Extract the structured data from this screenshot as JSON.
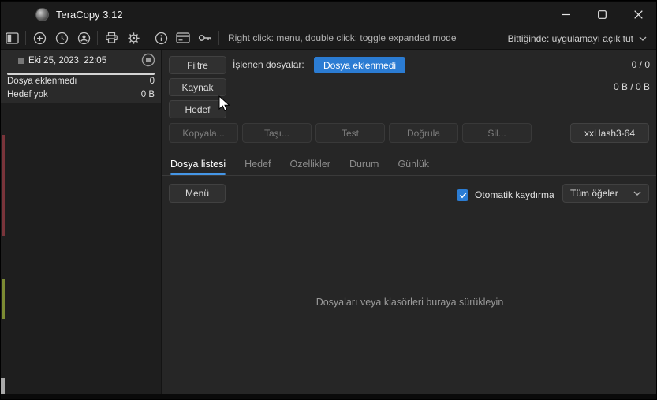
{
  "window": {
    "title": "TeraCopy 3.12"
  },
  "toolbar": {
    "icons": [
      "sidebar-toggle",
      "add",
      "history",
      "user",
      "print",
      "settings",
      "info",
      "license-card",
      "key"
    ],
    "hint": "Right click: menu, double click: toggle expanded mode",
    "on_finish": "Bittiğinde: uygulamayı açık tut"
  },
  "sidebar": {
    "task": {
      "date": "Eki 25, 2023, 22:05",
      "rows": [
        {
          "label": "Dosya eklenmedi",
          "value": "0"
        },
        {
          "label": "Hedef yok",
          "value": "0 B"
        }
      ]
    }
  },
  "main": {
    "filter_button": "Filtre",
    "processed_label": "İşlenen dosyalar:",
    "processed_badge": "Dosya eklenmedi",
    "file_count": "0 / 0",
    "source_button": "Kaynak",
    "byte_count": "0 B / 0 B",
    "target_button": "Hedef",
    "actions": [
      "Kopyala...",
      "Taşı...",
      "Test",
      "Doğrula",
      "Sil..."
    ],
    "hash_button": "xxHash3-64",
    "tabs": [
      "Dosya listesi",
      "Hedef",
      "Özellikler",
      "Durum",
      "Günlük"
    ],
    "active_tab": "Dosya listesi",
    "menu_button": "Menü",
    "autoscroll_label": "Otomatik kaydırma",
    "autoscroll_checked": "true",
    "filter_select": "Tüm öğeler",
    "empty_hint": "Dosyaları veya klasörleri buraya sürükleyin"
  },
  "colors": {
    "accent_blue": "#2b7cd3",
    "tab_underline": "#4596e6",
    "stripe_red": "#79343a",
    "stripe_green": "#7c8b33"
  }
}
